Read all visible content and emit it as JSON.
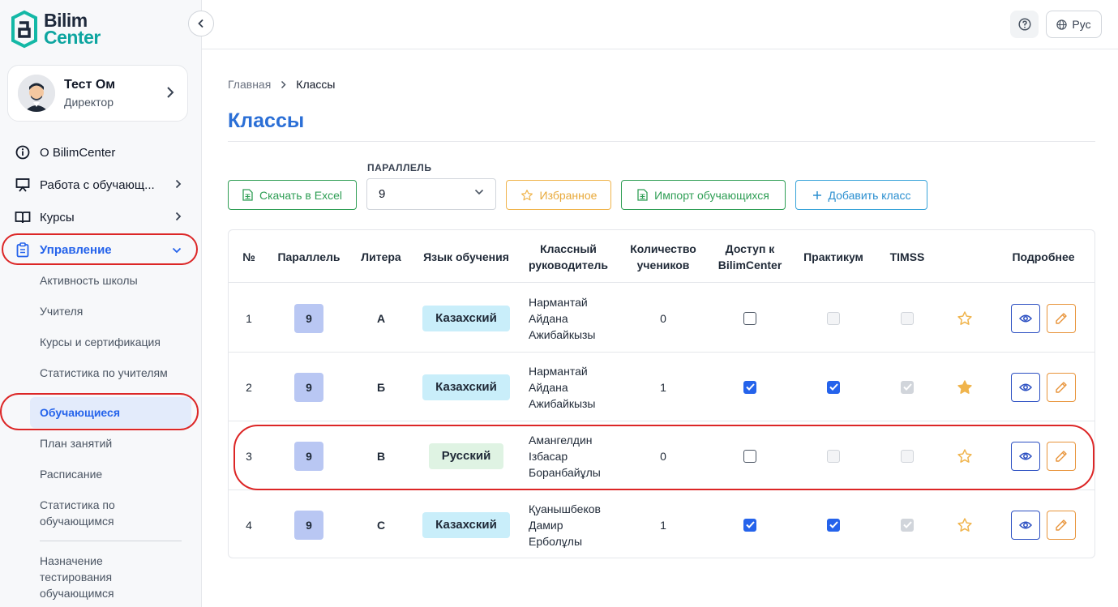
{
  "brand": {
    "line1": "Bilim",
    "line2": "Center"
  },
  "profile": {
    "name": "Тест Ом",
    "role": "Директор"
  },
  "nav": {
    "about": "О BilimCenter",
    "work_students": "Работа с обучающ...",
    "courses": "Курсы",
    "management": "Управление"
  },
  "subnav": [
    "Активность школы",
    "Учителя",
    "Курсы и сертификация",
    "Статистика по учителям",
    "Обучающиеся",
    "План занятий",
    "Расписание",
    "Статистика по обучающимся",
    "Назначение тестирования обучающимся"
  ],
  "topbar": {
    "lang": "Рус"
  },
  "breadcrumb": {
    "home": "Главная",
    "current": "Классы"
  },
  "page_title": "Классы",
  "toolbar": {
    "excel": "Скачать в Excel",
    "parallel_label": "ПАРАЛЛЕЛЬ",
    "parallel_value": "9",
    "favorites": "Избранное",
    "import": "Импорт обучающихся",
    "add_class": "Добавить класс"
  },
  "table": {
    "headers": [
      "№",
      "Параллель",
      "Литера",
      "Язык обучения",
      "Классный руководитель",
      "Количество учеников",
      "Доступ к BilimCenter",
      "Практикум",
      "TIMSS",
      "",
      "Подробнее"
    ],
    "rows": [
      {
        "num": "1",
        "parallel": "9",
        "letter": "А",
        "language": "Казахский",
        "teacher": [
          "Нармантай",
          "Айдана",
          "Ажибайкызы"
        ],
        "count": "0",
        "access": false,
        "practicum": false,
        "timss": false,
        "favorite": false
      },
      {
        "num": "2",
        "parallel": "9",
        "letter": "Б",
        "language": "Казахский",
        "teacher": [
          "Нармантай",
          "Айдана",
          "Ажибайкызы"
        ],
        "count": "1",
        "access": true,
        "practicum": true,
        "timss": true,
        "favorite": true
      },
      {
        "num": "3",
        "parallel": "9",
        "letter": "В",
        "language": "Русский",
        "teacher": [
          "Амангелдин",
          "Ізбасар",
          "Боранбайұлы"
        ],
        "count": "0",
        "access": false,
        "practicum": false,
        "timss": false,
        "favorite": false
      },
      {
        "num": "4",
        "parallel": "9",
        "letter": "С",
        "language": "Казахский",
        "teacher": [
          "Қуанышбеков",
          "Дамир",
          "Ерболұлы"
        ],
        "count": "1",
        "access": true,
        "practicum": true,
        "timss": true,
        "favorite": false
      }
    ]
  },
  "colors": {
    "accent": "#2b6fd6",
    "kazakh_badge": "#c9eefa",
    "russian_badge": "#dff3e3",
    "parallel_badge": "#b9c7f3",
    "highlight": "#dc2626"
  }
}
